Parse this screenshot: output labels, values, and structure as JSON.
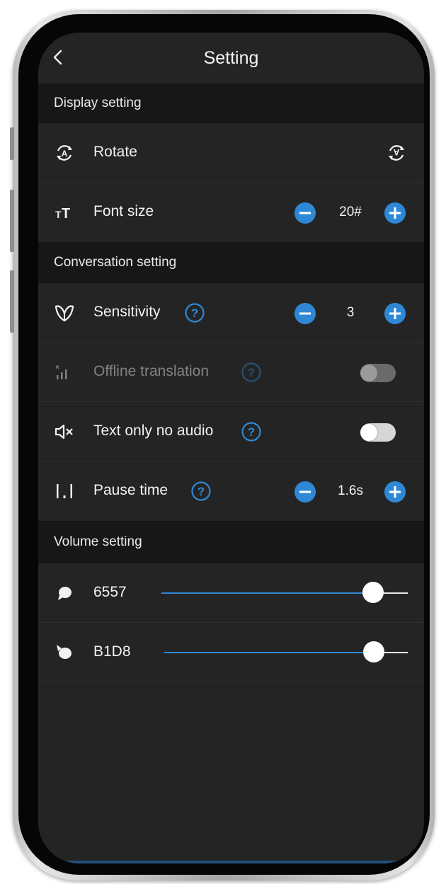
{
  "header": {
    "title": "Setting",
    "back_icon": "chevron-left-icon"
  },
  "colors": {
    "accent": "#2f88d6",
    "background": "#242424",
    "section_background": "#171717",
    "text": "#f2f2f2"
  },
  "sections": {
    "display": {
      "title": "Display setting",
      "rotate": {
        "label": "Rotate",
        "icon": "rotate-a-icon",
        "action_icon": "rotate-refresh-icon"
      },
      "font_size": {
        "label": "Font size",
        "icon": "font-size-icon",
        "value": "20#"
      }
    },
    "conversation": {
      "title": "Conversation setting",
      "sensitivity": {
        "label": "Sensitivity",
        "icon": "sensitivity-icon",
        "value": "3"
      },
      "offline_translation": {
        "label": "Offline translation",
        "icon": "offline-signal-icon",
        "enabled": false,
        "disabled": true
      },
      "text_only": {
        "label": "Text only no audio",
        "icon": "mute-icon",
        "enabled": false
      },
      "pause_time": {
        "label": "Pause time",
        "icon": "pause-time-icon",
        "value": "1.6s"
      }
    },
    "volume": {
      "title": "Volume setting",
      "speaker_1": {
        "label": "6557",
        "icon": "speech-bubble-icon",
        "level": 0.86
      },
      "speaker_2": {
        "label": "B1D8",
        "icon": "speech-bubble-alt-icon",
        "level": 0.86
      }
    }
  }
}
